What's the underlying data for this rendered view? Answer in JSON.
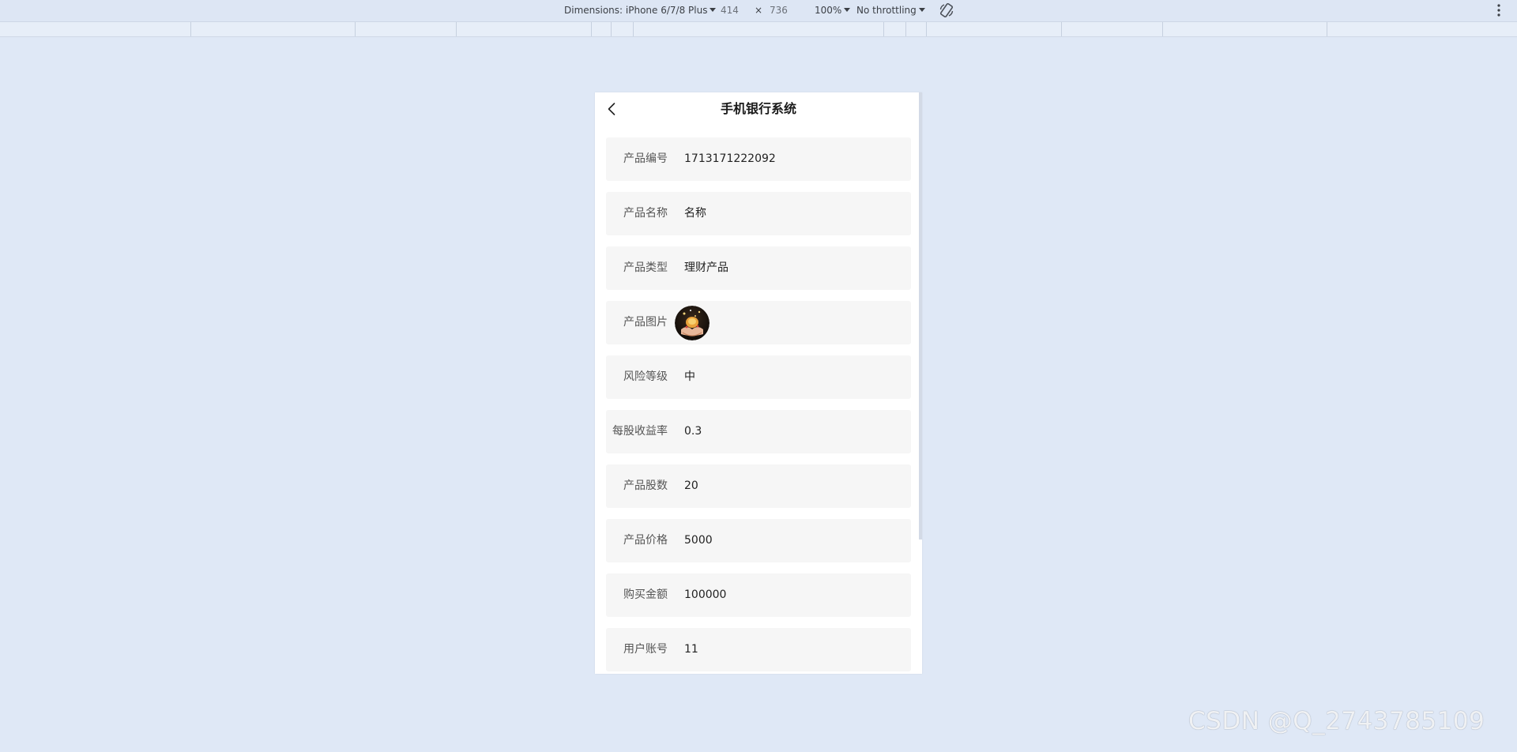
{
  "devtools": {
    "device_label": "Dimensions: iPhone 6/7/8 Plus",
    "width_value": "414",
    "times_sign": "×",
    "height_value": "736",
    "zoom_label": "100%",
    "throttling_label": "No throttling"
  },
  "app": {
    "title": "手机银行系统"
  },
  "details": [
    {
      "label": "产品编号",
      "value": "1713171222092",
      "kind": "text"
    },
    {
      "label": "产品名称",
      "value": "名称",
      "kind": "text"
    },
    {
      "label": "产品类型",
      "value": "理财产品",
      "kind": "text"
    },
    {
      "label": "产品图片",
      "value": "",
      "kind": "image"
    },
    {
      "label": "风险等级",
      "value": "中",
      "kind": "text"
    },
    {
      "label": "每股收益率",
      "value": "0.3",
      "kind": "text"
    },
    {
      "label": "产品股数",
      "value": "20",
      "kind": "text"
    },
    {
      "label": "产品价格",
      "value": "5000",
      "kind": "text"
    },
    {
      "label": "购买金额",
      "value": "100000",
      "kind": "text"
    },
    {
      "label": "用户账号",
      "value": "11",
      "kind": "text"
    }
  ],
  "watermark": "CSDN @Q_2743785109",
  "icons": {
    "back": "chevron-left-icon",
    "rotate": "rotate-device-icon",
    "more": "more-vertical-icon",
    "avatar": "product-image-thumbnail"
  }
}
